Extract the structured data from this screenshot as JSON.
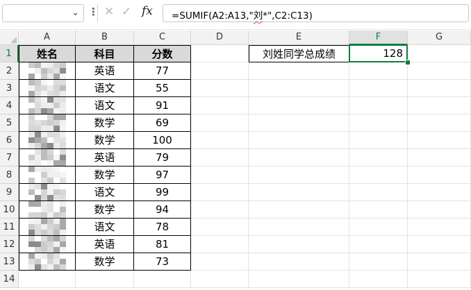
{
  "formula_bar": {
    "name_box": "",
    "formula_prefix": "=SUMIF(A2:A13,\"",
    "formula_highlight": "刘",
    "formula_suffix": "*\",C2:C13)"
  },
  "columns": [
    "A",
    "B",
    "C",
    "D",
    "E",
    "F",
    "G"
  ],
  "rows": [
    "1",
    "2",
    "3",
    "4",
    "5",
    "6",
    "7",
    "8",
    "9",
    "10",
    "11",
    "12",
    "13",
    "14"
  ],
  "table": {
    "headers": [
      "姓名",
      "科目",
      "分数"
    ],
    "rows": [
      {
        "subject": "英语",
        "score": "77"
      },
      {
        "subject": "语文",
        "score": "55"
      },
      {
        "subject": "语文",
        "score": "91"
      },
      {
        "subject": "数学",
        "score": "69"
      },
      {
        "subject": "数学",
        "score": "100"
      },
      {
        "subject": "英语",
        "score": "79"
      },
      {
        "subject": "数学",
        "score": "97"
      },
      {
        "subject": "语文",
        "score": "99"
      },
      {
        "subject": "数学",
        "score": "94"
      },
      {
        "subject": "语文",
        "score": "78"
      },
      {
        "subject": "英语",
        "score": "81"
      },
      {
        "subject": "数学",
        "score": "73"
      }
    ]
  },
  "summary": {
    "label": "刘姓同学总成绩",
    "value": "128"
  },
  "selected_cell": "F1",
  "colors": {
    "accent": "#107c41",
    "header_fill": "#d9d9d9"
  }
}
